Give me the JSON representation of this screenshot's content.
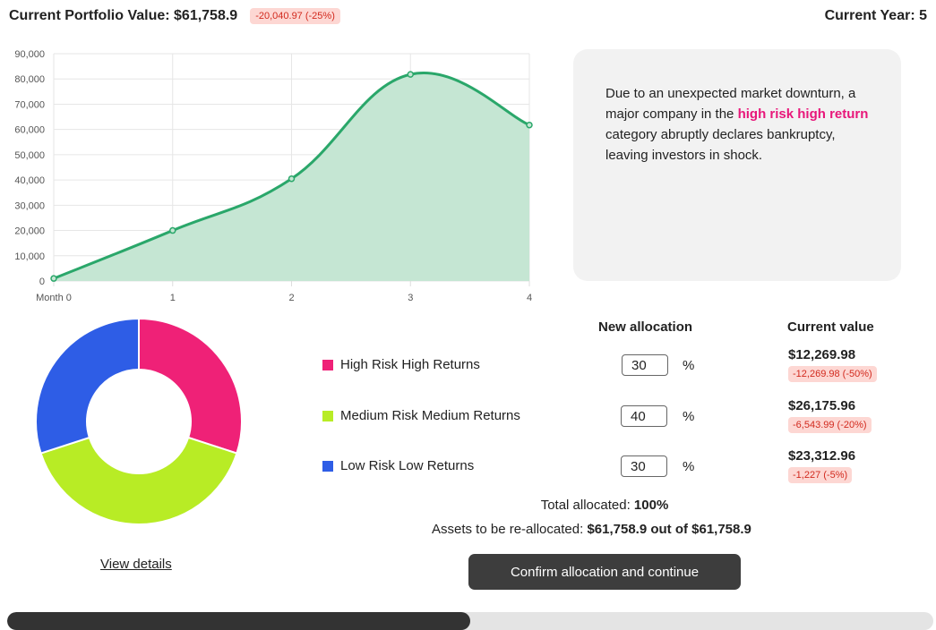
{
  "header": {
    "portfolio_label": "Current Portfolio Value: $61,758.9",
    "portfolio_change": "-20,040.97 (-25%)",
    "year_label": "Current Year: 5"
  },
  "event": {
    "text_before": "Due to an unexpected market downturn, a major company in the ",
    "highlight": "high risk high return",
    "text_after": " category abruptly declares bankruptcy, leaving investors in shock."
  },
  "chart_data": {
    "type": "area",
    "categories": [
      "Month 0",
      "1",
      "2",
      "3",
      "4"
    ],
    "values": [
      1000,
      20000,
      40500,
      81800,
      61758.9
    ],
    "ylim": [
      0,
      90000
    ],
    "yticks": [
      "0",
      "10,000",
      "20,000",
      "30,000",
      "40,000",
      "50,000",
      "60,000",
      "70,000",
      "80,000",
      "90,000"
    ],
    "grid": true,
    "line_color": "#2aa76a",
    "fill_color": "#c5e6d3"
  },
  "donut": {
    "slices": [
      {
        "name": "High Risk High Returns",
        "value": 30,
        "color": "#ef2177"
      },
      {
        "name": "Medium Risk Medium Returns",
        "value": 40,
        "color": "#b8ec25"
      },
      {
        "name": "Low Risk Low Returns",
        "value": 30,
        "color": "#2e5de6"
      }
    ]
  },
  "view_details": "View details",
  "table": {
    "new_allocation_header": "New allocation",
    "current_value_header": "Current value",
    "percent_sign": "%",
    "rows": [
      {
        "name": "High Risk High Returns",
        "color": "#ef2177",
        "allocation": "30",
        "current_value": "$12,269.98",
        "change": "-12,269.98 (-50%)"
      },
      {
        "name": "Medium Risk Medium Returns",
        "color": "#b8ec25",
        "allocation": "40",
        "current_value": "$26,175.96",
        "change": "-6,543.99 (-20%)"
      },
      {
        "name": "Low Risk Low Returns",
        "color": "#2e5de6",
        "allocation": "30",
        "current_value": "$23,312.96",
        "change": "-1,227 (-5%)"
      }
    ]
  },
  "total": {
    "label": "Total allocated: ",
    "value": "100%"
  },
  "assets": {
    "label": "Assets to be re-allocated: ",
    "value": "$61,758.9 out of $61,758.9"
  },
  "confirm_label": "Confirm allocation and continue",
  "progress": {
    "fraction": 0.5
  }
}
